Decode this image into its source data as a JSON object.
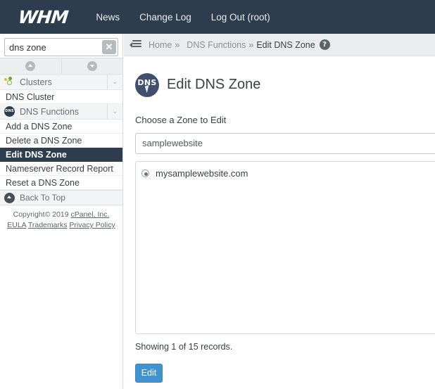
{
  "header": {
    "logo": "WHM",
    "nav": [
      {
        "label": "News"
      },
      {
        "label": "Change Log"
      },
      {
        "label": "Log Out (root)"
      }
    ]
  },
  "sidebar": {
    "search": {
      "value": "dns zone",
      "placeholder": ""
    },
    "clear_label": "✕",
    "collapse_all_title": "Collapse All",
    "expand_all_title": "Expand All",
    "categories": [
      {
        "label": "Clusters",
        "icon": "clusters-icon",
        "chevron": "⌄",
        "items": [
          {
            "label": "DNS Cluster",
            "active": false
          }
        ]
      },
      {
        "label": "DNS Functions",
        "icon": "dns-icon",
        "chevron": "⌄",
        "items": [
          {
            "label": "Add a DNS Zone",
            "active": false
          },
          {
            "label": "Delete a DNS Zone",
            "active": false
          },
          {
            "label": "Edit DNS Zone",
            "active": true
          },
          {
            "label": "Nameserver Record Report",
            "active": false
          },
          {
            "label": "Reset a DNS Zone",
            "active": false
          }
        ]
      }
    ],
    "back_to_top": "Back To Top",
    "footer": {
      "copyright": "Copyright© 2019 ",
      "company": "cPanel, Inc.",
      "links": [
        {
          "label": "EULA"
        },
        {
          "label": "Trademarks"
        },
        {
          "label": "Privacy Policy"
        }
      ]
    }
  },
  "breadcrumb": {
    "home": "Home",
    "sep1": "»",
    "section": "DNS Functions",
    "sep2": "»",
    "current": "Edit DNS Zone",
    "help": "?"
  },
  "main": {
    "badge_text": "DNS",
    "title": "Edit DNS Zone",
    "subtitle": "Choose a Zone to Edit",
    "filter": {
      "value": "samplewebsite",
      "placeholder": ""
    },
    "zones": [
      {
        "name": "mysamplewebsite.com",
        "selected": true
      }
    ],
    "records_note": "Showing 1 of 15 records.",
    "edit_label": "Edit"
  },
  "colors": {
    "header_bg": "#2e3d4d",
    "accent_button": "#3f93d1",
    "active_item_bg": "#2e3d4d",
    "breadcrumb_bg": "#eaecee"
  }
}
